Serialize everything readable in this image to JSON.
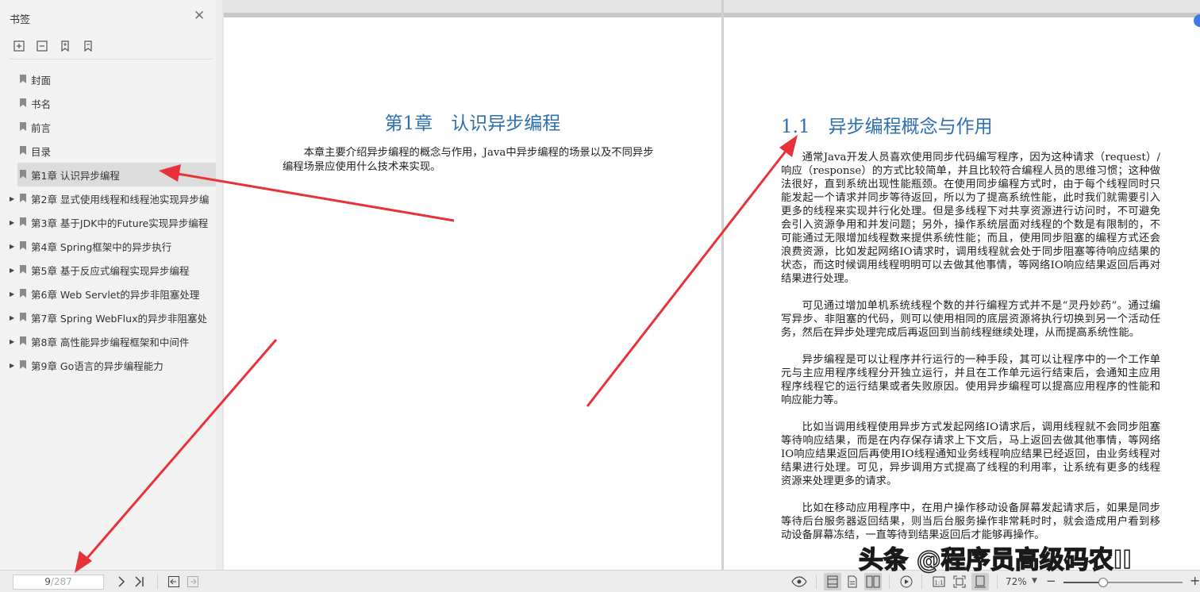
{
  "sidebar": {
    "title": "书签",
    "close_glyph": "✕",
    "tools": [
      {
        "icon": "expand-bookmarks-icon"
      },
      {
        "icon": "collapse-bookmarks-icon"
      },
      {
        "icon": "add-bookmark-icon"
      },
      {
        "icon": "remove-bookmark-icon"
      }
    ],
    "bookmarks": [
      {
        "label": "封面",
        "expandable": false,
        "active": false
      },
      {
        "label": "书名",
        "expandable": false,
        "active": false
      },
      {
        "label": "前言",
        "expandable": false,
        "active": false
      },
      {
        "label": "目录",
        "expandable": false,
        "active": false
      },
      {
        "label": "第1章 认识异步编程",
        "expandable": true,
        "active": true
      },
      {
        "label": "第2章 显式使用线程和线程池实现异步编",
        "expandable": true,
        "active": false
      },
      {
        "label": "第3章 基于JDK中的Future实现异步编程",
        "expandable": true,
        "active": false
      },
      {
        "label": "第4章 Spring框架中的异步执行",
        "expandable": true,
        "active": false
      },
      {
        "label": "第5章 基于反应式编程实现异步编程",
        "expandable": true,
        "active": false
      },
      {
        "label": "第6章 Web Servlet的异步非阻塞处理",
        "expandable": true,
        "active": false
      },
      {
        "label": "第7章 Spring WebFlux的异步非阻塞处",
        "expandable": true,
        "active": false
      },
      {
        "label": "第8章 高性能异步编程框架和中间件",
        "expandable": true,
        "active": false
      },
      {
        "label": "第9章 Go语言的异步编程能力",
        "expandable": true,
        "active": false
      }
    ]
  },
  "left_page": {
    "chapter_title": "第1章　认识异步编程",
    "intro": "本章主要介绍异步编程的概念与作用，Java中异步编程的场景以及不同异步编程场景应使用什么技术来实现。"
  },
  "right_page": {
    "section_title": "1.1　异步编程概念与作用",
    "paragraphs": [
      "通常Java开发人员喜欢使用同步代码编写程序，因为这种请求（request）/响应（response）的方式比较简单，并且比较符合编程人员的思维习惯；这种做法很好，直到系统出现性能瓶颈。在使用同步编程方式时，由于每个线程同时只能发起一个请求并同步等待返回，所以为了提高系统性能，此时我们就需要引入更多的线程来实现并行化处理。但是多线程下对共享资源进行访问时，不可避免会引入资源争用和并发问题；另外，操作系统层面对线程的个数是有限制的，不可能通过无限增加线程数来提供系统性能；而且，使用同步阻塞的编程方式还会浪费资源，比如发起网络IO请求时，调用线程就会处于同步阻塞等待响应结果的状态，而这时候调用线程明明可以去做其他事情，等网络IO响应结果返回后再对结果进行处理。",
      "可见通过增加单机系统线程个数的并行编程方式并不是“灵丹妙药”。通过编写异步、非阻塞的代码，则可以使用相同的底层资源将执行切换到另一个活动任务，然后在异步处理完成后再返回到当前线程继续处理，从而提高系统性能。",
      "异步编程是可以让程序并行运行的一种手段，其可以让程序中的一个工作单元与主应用程序线程分开独立运行，并且在工作单元运行结束后，会通知主应用程序线程它的运行结果或者失败原因。使用异步编程可以提高应用程序的性能和响应能力等。",
      "比如当调用线程使用异步方式发起网络IO请求后，调用线程就不会同步阻塞等待响应结果，而是在内存保存请求上下文后，马上返回去做其他事情，等网络IO响应结果返回后再使用IO线程通知业务线程响应结果已经返回，由业务线程对结果进行处理。可见，异步调用方式提高了线程的利用率，让系统有更多的线程资源来处理更多的请求。",
      "比如在移动应用程序中，在用户操作移动设备屏幕发起请求后，如果是同步等待后台服务器返回结果，则当后台服务操作非常耗时时，就会造成用户看到移动设备屏幕冻结，一直等待到结果返回后才能够再操作。"
    ]
  },
  "status_bar": {
    "current_page": "9",
    "total_pages": "/287",
    "zoom": "72%",
    "zoom_fraction": 0.33
  },
  "watermark": "头条 @程序员高级码农II",
  "colors": {
    "heading_blue": "#2f6fb0",
    "annotation_red": "#e8323a",
    "accent_blue": "#3b7de0"
  }
}
